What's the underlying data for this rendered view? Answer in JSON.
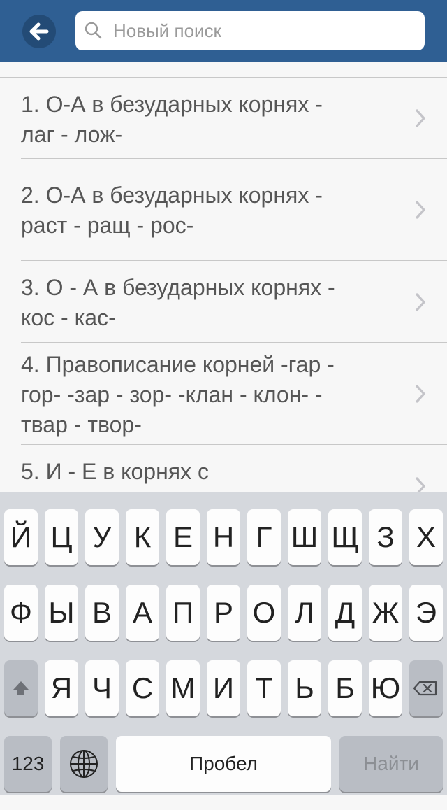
{
  "header": {
    "search_placeholder": "Новый поиск"
  },
  "list": {
    "items": [
      {
        "lines": [
          "1. О-А в безударных корнях -",
          "лаг - лож-"
        ]
      },
      {
        "lines": [
          "2. О-А в безударных корнях -",
          "раст - ращ - рос-"
        ]
      },
      {
        "lines": [
          "3. О - А в безударных корнях -",
          "кос - кас-"
        ]
      },
      {
        "lines": [
          "4. Правописание корней -гар -",
          "гор- -зар - зор- -клан - клон- -",
          "твар - твор-"
        ]
      },
      {
        "lines": [
          "5. И - Е в корнях с",
          ""
        ]
      }
    ]
  },
  "keyboard": {
    "row1": [
      "Й",
      "Ц",
      "У",
      "К",
      "Е",
      "Н",
      "Г",
      "Ш",
      "Щ",
      "З",
      "Х"
    ],
    "row2": [
      "Ф",
      "Ы",
      "В",
      "А",
      "П",
      "Р",
      "О",
      "Л",
      "Д",
      "Ж",
      "Э"
    ],
    "row3": [
      "Я",
      "Ч",
      "С",
      "М",
      "И",
      "Т",
      "Ь",
      "Б",
      "Ю"
    ],
    "numbers_label": "123",
    "space_label": "Пробел",
    "return_label": "Найти"
  }
}
